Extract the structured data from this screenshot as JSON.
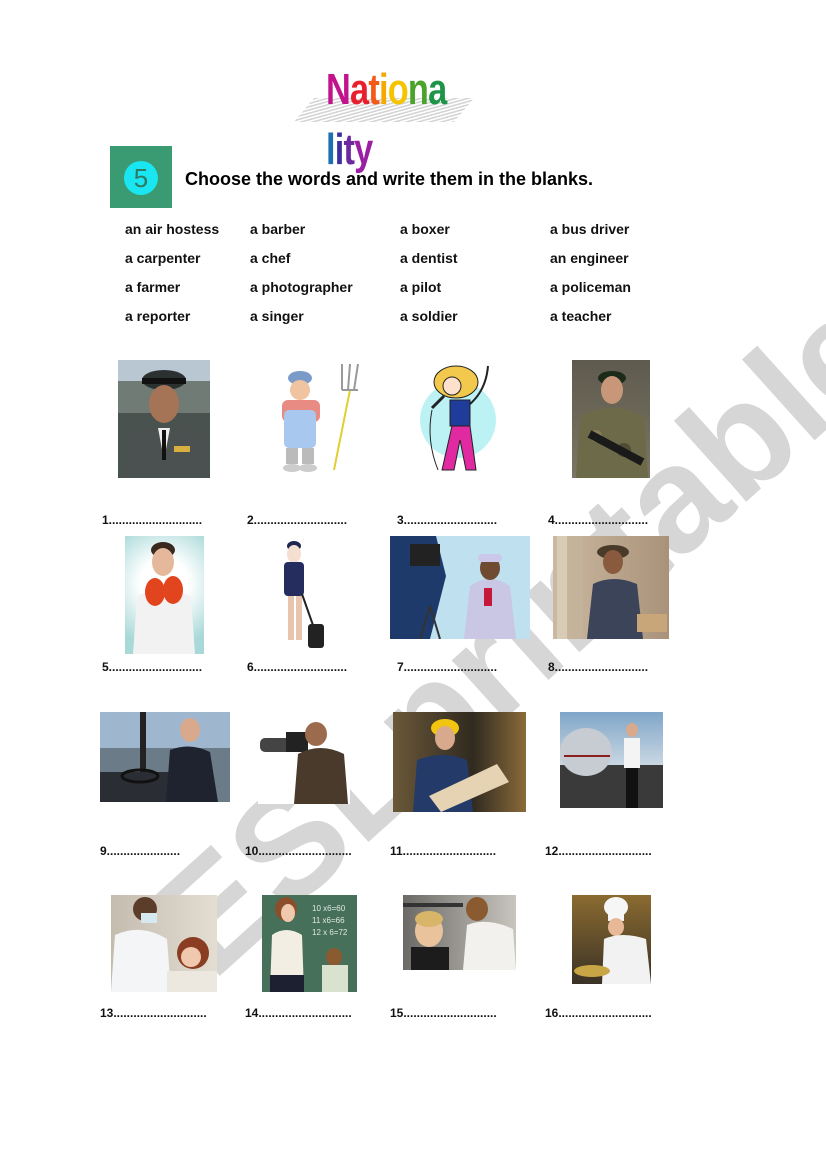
{
  "title": {
    "text": "Nationality",
    "letter_colors": [
      "#c2138d",
      "#e81f2c",
      "#f25a16",
      "#f6a800",
      "#f5c400",
      "#4aa42c",
      "#1d9447",
      "#1b6fb5",
      "#3a2ea0",
      "#6d2aa0",
      "#9b1fa5"
    ]
  },
  "exercise": {
    "number": "5",
    "instruction": "Choose the words and write them in the blanks.",
    "badge_color": "#3a9b72",
    "circle_color": "#19e6f0"
  },
  "word_bank": [
    [
      "an air hostess",
      "a barber",
      "a boxer",
      "a bus driver"
    ],
    [
      "a carpenter",
      "a chef",
      "a dentist",
      "an engineer"
    ],
    [
      "a farmer",
      "a photographer",
      "a pilot",
      "a policeman"
    ],
    [
      "a reporter",
      "a singer",
      "a soldier",
      "a teacher"
    ]
  ],
  "pictures": [
    {
      "label": "1............................",
      "subject": "soldier in dress uniform"
    },
    {
      "label": "2............................",
      "subject": "cartoon farmer with pitchfork"
    },
    {
      "label": "3............................",
      "subject": "cartoon singer with microphone"
    },
    {
      "label": "4............................",
      "subject": "soldier in camouflage with rifle"
    },
    {
      "label": "5............................",
      "subject": "boxer with red gloves"
    },
    {
      "label": "6............................",
      "subject": "air hostess with suitcase"
    },
    {
      "label": "7............................",
      "subject": "reporter with microphone"
    },
    {
      "label": "8............................",
      "subject": "carpenter working wood"
    },
    {
      "label": "9......................",
      "subject": "bus driver at wheel"
    },
    {
      "label": "10............................",
      "subject": "photographer with camera"
    },
    {
      "label": "11............................",
      "subject": "engineer with hard hat reading plans"
    },
    {
      "label": "12............................",
      "subject": "pilot in front of jet"
    },
    {
      "label": "13............................",
      "subject": "dentist with patient"
    },
    {
      "label": "14............................",
      "subject": "teacher at chalkboard"
    },
    {
      "label": "15............................",
      "subject": "barber cutting boy's hair"
    },
    {
      "label": "16............................",
      "subject": "chef cooking in kitchen"
    }
  ],
  "watermark": "ESLprintables.com"
}
